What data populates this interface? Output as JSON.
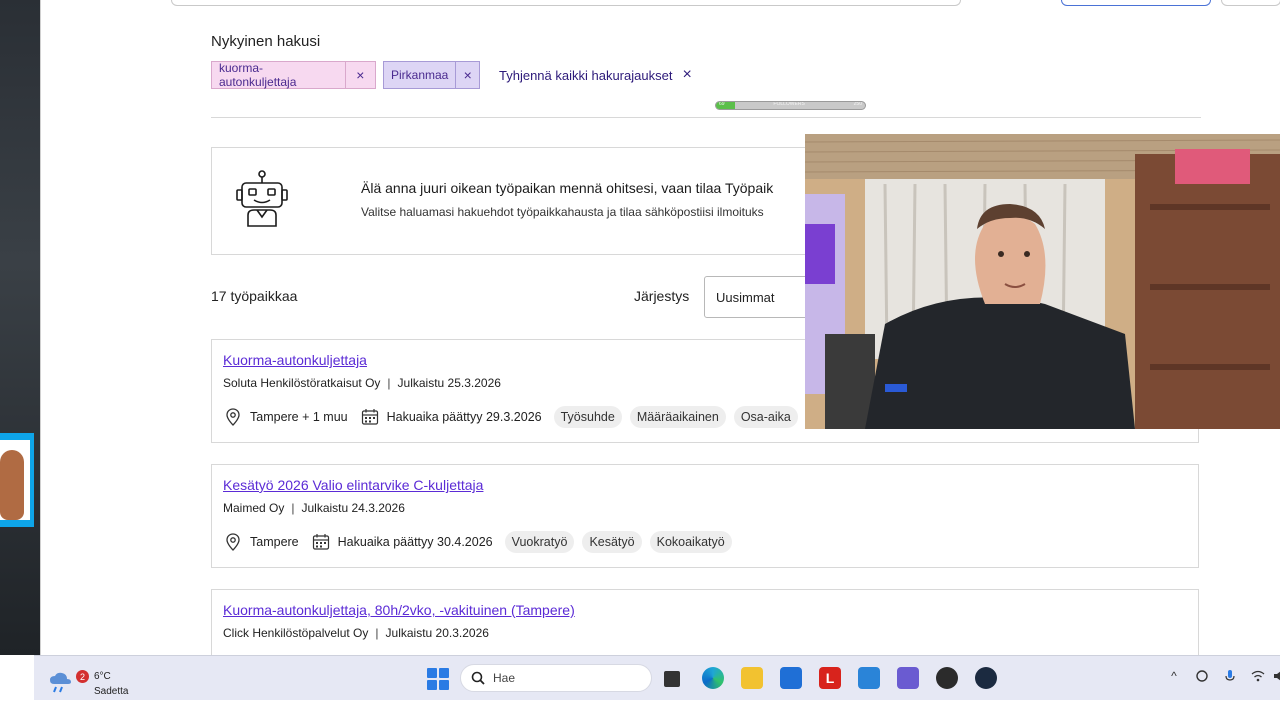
{
  "search": {
    "heading": "Nykyinen hakusi",
    "chips": [
      {
        "label": "kuorma-autonkuljettaja",
        "remove": "×"
      },
      {
        "label": "Pirkanmaa",
        "remove": "×"
      }
    ],
    "clear_all": "Tyhjennä kaikki hakurajaukset",
    "clear_icon": "×"
  },
  "overlay_bar": {
    "left": "69",
    "middle": "FOLLOWERS",
    "right": "250",
    "fill_fraction": 0.13
  },
  "alert": {
    "title": "Älä anna juuri oikean työpaikan mennä ohitsesi, vaan tilaa Työpaik",
    "subtitle": "Valitse haluamasi hakuehdot työpaikkahausta ja tilaa sähköpostiisi ilmoituks",
    "icon": "robot-icon"
  },
  "results": {
    "count": "17 työpaikkaa",
    "sort_label": "Järjestys",
    "sort_value": "Uusimmat"
  },
  "jobs": [
    {
      "title": "Kuorma-autonkuljettaja",
      "company": "Soluta Henkilöstöratkaisut Oy",
      "sep": "|",
      "published": "Julkaistu 25.3.2026",
      "location": "Tampere + 1 muu",
      "deadline": "Hakuaika päättyy 29.3.2026",
      "tags": [
        "Työsuhde",
        "Määräaikainen",
        "Osa-aika"
      ]
    },
    {
      "title": "Kesätyö 2026 Valio elintarvike C-kuljettaja",
      "company": "Maimed Oy",
      "sep": "|",
      "published": "Julkaistu 24.3.2026",
      "location": "Tampere",
      "deadline": "Hakuaika päättyy 30.4.2026",
      "tags": [
        "Vuokratyö",
        "Kesätyö",
        "Kokoaikatyö"
      ]
    },
    {
      "title": "Kuorma-autonkuljettaja, 80h/2vko, -vakituinen (Tampere)",
      "company": "Click Henkilöstöpalvelut Oy",
      "sep": "|",
      "published": "Julkaistu 20.3.2026"
    }
  ],
  "taskbar": {
    "weather_badge": "2",
    "temperature": "6°C",
    "weather_desc": "Sadetta",
    "search_placeholder": "Hae",
    "icons": [
      "start-icon",
      "task-view-icon",
      "edge-icon",
      "file-explorer-icon",
      "store-icon",
      "l-app-icon",
      "outlook-icon",
      "teams-icon",
      "obs-icon",
      "steam-icon"
    ]
  },
  "colors": {
    "link": "#5b2bd6",
    "chip_pink": "#f7d9f0",
    "chip_purple": "#ddd5f5",
    "accent": "#2d1a7a"
  }
}
